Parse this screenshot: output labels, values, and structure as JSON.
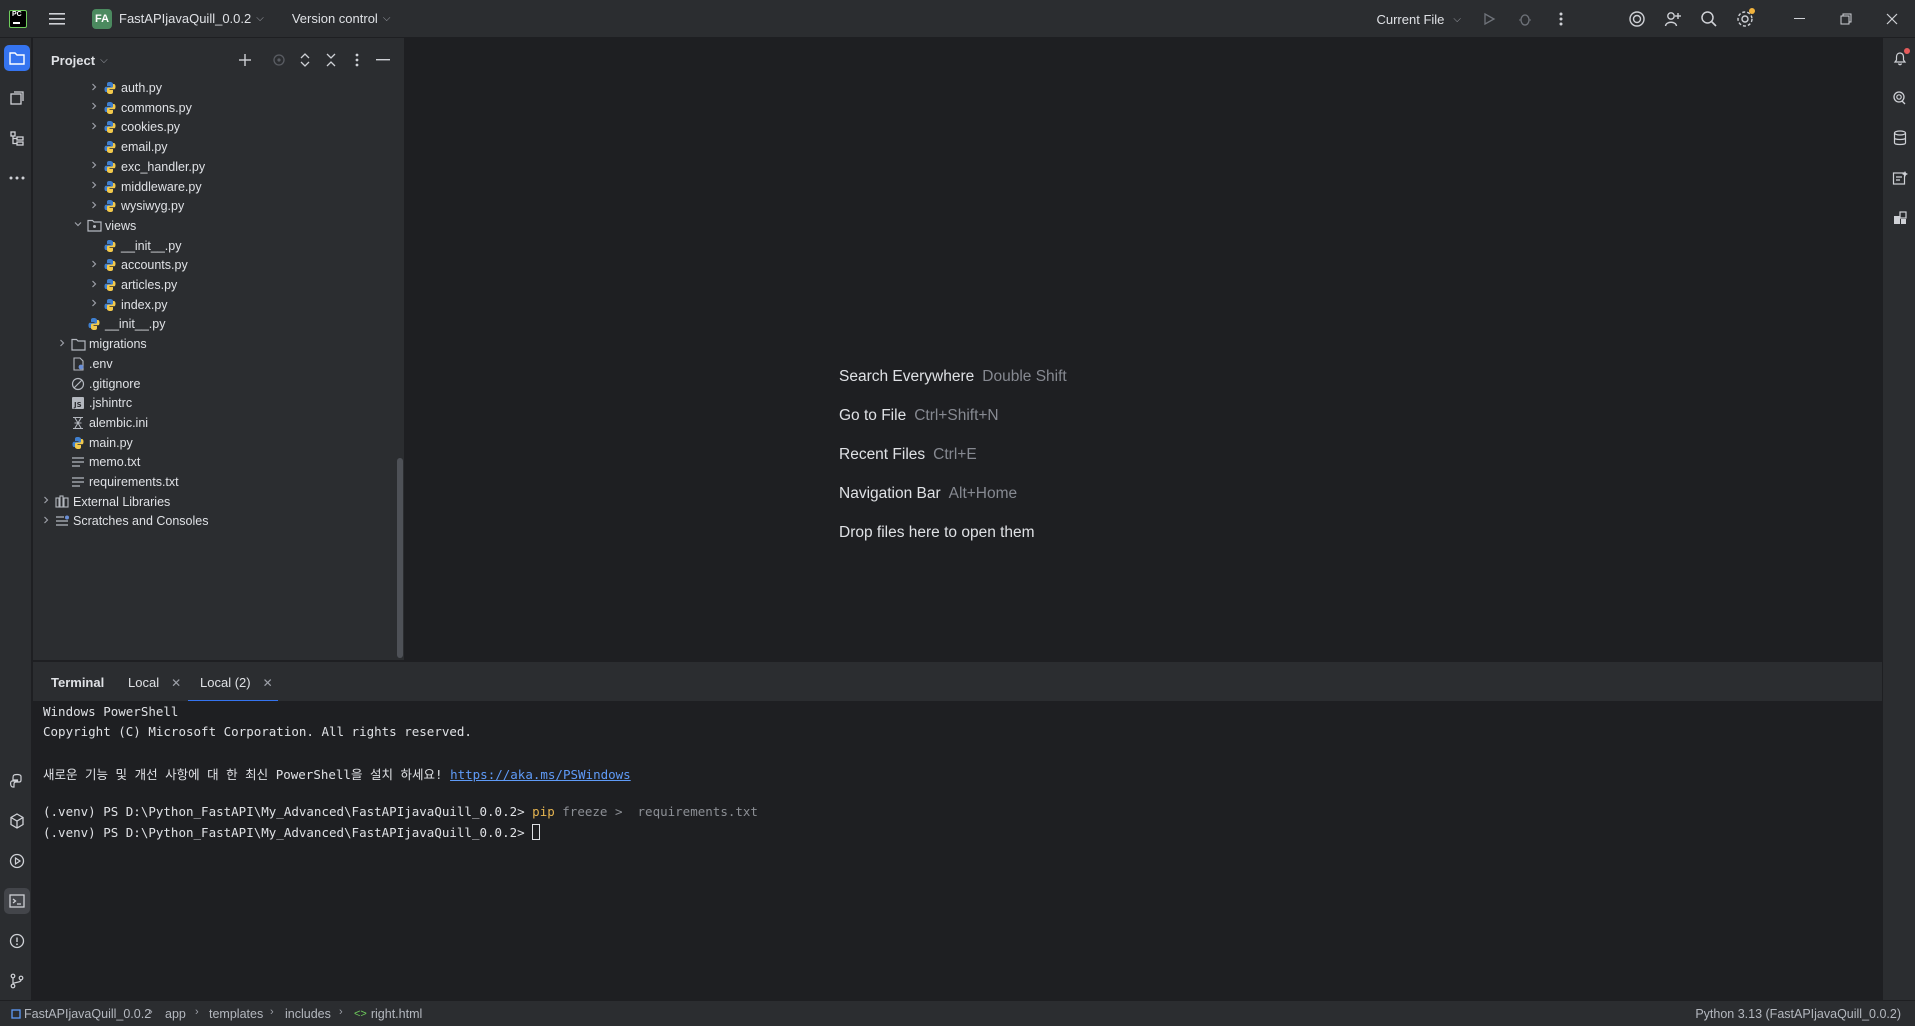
{
  "titlebar": {
    "project_badge": "FA",
    "project_name": "FastAPIjavaQuill_0.0.2",
    "version_control": "Version control",
    "current_file": "Current File"
  },
  "project_panel": {
    "title": "Project",
    "tree": [
      {
        "label": "auth.py",
        "icon": "python-file-icon",
        "expandable": true
      },
      {
        "label": "commons.py",
        "icon": "python-file-icon",
        "expandable": true
      },
      {
        "label": "cookies.py",
        "icon": "python-file-icon",
        "expandable": true
      },
      {
        "label": "email.py",
        "icon": "python-file-icon",
        "expandable": false
      },
      {
        "label": "exc_handler.py",
        "icon": "python-file-icon",
        "expandable": true
      },
      {
        "label": "middleware.py",
        "icon": "python-file-icon",
        "expandable": true
      },
      {
        "label": "wysiwyg.py",
        "icon": "python-file-icon",
        "expandable": true
      },
      {
        "label": "views",
        "icon": "package-folder-icon",
        "expandable": true,
        "expanded": true
      },
      {
        "label": "__init__.py",
        "icon": "python-file-icon",
        "expandable": false
      },
      {
        "label": "accounts.py",
        "icon": "python-file-icon",
        "expandable": true
      },
      {
        "label": "articles.py",
        "icon": "python-file-icon",
        "expandable": true
      },
      {
        "label": "index.py",
        "icon": "python-file-icon",
        "expandable": true
      },
      {
        "label": "__init__.py",
        "icon": "python-file-icon",
        "expandable": false
      },
      {
        "label": "migrations",
        "icon": "folder-icon",
        "expandable": true
      },
      {
        "label": ".env",
        "icon": "env-file-icon",
        "expandable": false
      },
      {
        "label": ".gitignore",
        "icon": "ignore-file-icon",
        "expandable": false
      },
      {
        "label": ".jshintrc",
        "icon": "js-file-icon",
        "expandable": false
      },
      {
        "label": "alembic.ini",
        "icon": "ini-file-icon",
        "expandable": false
      },
      {
        "label": "main.py",
        "icon": "python-file-icon",
        "expandable": false
      },
      {
        "label": "memo.txt",
        "icon": "text-file-icon",
        "expandable": false
      },
      {
        "label": "requirements.txt",
        "icon": "text-file-icon",
        "expandable": false
      },
      {
        "label": "External Libraries",
        "icon": "library-icon",
        "expandable": true
      },
      {
        "label": "Scratches and Consoles",
        "icon": "scratches-icon",
        "expandable": true
      }
    ]
  },
  "editor_hints": [
    {
      "label": "Search Everywhere",
      "shortcut": "Double Shift"
    },
    {
      "label": "Go to File",
      "shortcut": "Ctrl+Shift+N"
    },
    {
      "label": "Recent Files",
      "shortcut": "Ctrl+E"
    },
    {
      "label": "Navigation Bar",
      "shortcut": "Alt+Home"
    },
    {
      "label": "Drop files here to open them",
      "shortcut": ""
    }
  ],
  "terminal": {
    "title": "Terminal",
    "tabs": [
      "Local",
      "Local (2)"
    ],
    "line1": "Windows PowerShell",
    "line2": "Copyright (C) Microsoft Corporation. All rights reserved.",
    "line3_text": "새로운 기능 및 개선 사항에 대 한 최신 PowerShell을 설치 하세요! ",
    "line3_link": "https://aka.ms/PSWindows",
    "prompt": "(.venv) PS D:\\Python_FastAPI\\My_Advanced\\FastAPIjavaQuill_0.0.2> ",
    "cmd": "pip",
    "cmd_args": " freeze >  requirements.txt"
  },
  "statusbar": {
    "crumbs": [
      "FastAPIjavaQuill_0.0.2",
      "app",
      "templates",
      "includes",
      "right.html"
    ],
    "interpreter": "Python 3.13 (FastAPIjavaQuill_0.0.2)"
  }
}
